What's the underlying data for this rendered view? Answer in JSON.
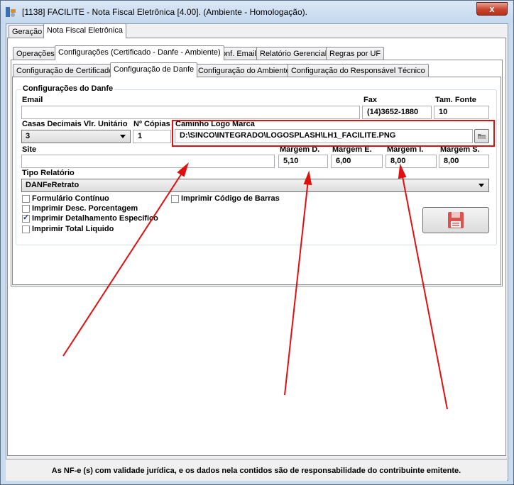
{
  "window": {
    "title": "[1138] FACILITE - Nota Fiscal Eletrônica [4.00]. (Ambiente - Homologação).",
    "close_label": "x"
  },
  "tabs_level1": [
    "Geração",
    "Nota Fiscal Eletrônica"
  ],
  "tabs_level2": [
    "Operações",
    "Configurações (Certificado - Danfe - Ambiente)",
    "Conf. Email",
    "Relatório Gerencial",
    "Regras por UF"
  ],
  "tabs_level3": [
    "Configuração de Certificado",
    "Configuração de Danfe",
    "Configuração do Ambiente",
    "Configuração do Responsável Técnico"
  ],
  "danfe": {
    "group_title": "Configurações do Danfe",
    "email_label": "Email",
    "email_value": "",
    "fax_label": "Fax",
    "fax_value": "(14)3652-1880",
    "font_size_label": "Tam. Fonte",
    "font_size_value": "10",
    "decimals_label": "Casas Decimais Vlr. Unitário",
    "decimals_value": "3",
    "copies_label": "Nº Cópias",
    "copies_value": "1",
    "logo_label": "Caminho Logo Marca",
    "logo_value": "D:\\SINCO\\INTEGRADO\\LOGOSPLASH\\LH1_FACILITE.PNG",
    "site_label": "Site",
    "site_value": "",
    "margin_right_label": "Margem D.",
    "margin_right_value": "5,10",
    "margin_left_label": "Margem E.",
    "margin_left_value": "6,00",
    "margin_bottom_label": "Margem I.",
    "margin_bottom_value": "8,00",
    "margin_top_label": "Margem S.",
    "margin_top_value": "8,00",
    "report_type_label": "Tipo Relatório",
    "report_type_value": "DANFeRetrato",
    "checkboxes": [
      {
        "label": "Formulário Contínuo",
        "checked": false
      },
      {
        "label": "Imprimir Código de Barras",
        "checked": false
      },
      {
        "label": "Imprimir Desc. Porcentagem",
        "checked": false
      },
      {
        "label": "Imprimir Detalhamento Específico",
        "checked": true
      },
      {
        "label": "Imprimir Total Liquido",
        "checked": false
      }
    ]
  },
  "footer_text": "As NF-e (s) com validade jurídica, e os dados nela contidos são de responsabilidade do contribuinte emitente.",
  "colors": {
    "annotation_red": "#e01010",
    "save_icon_red": "#d9534f"
  }
}
